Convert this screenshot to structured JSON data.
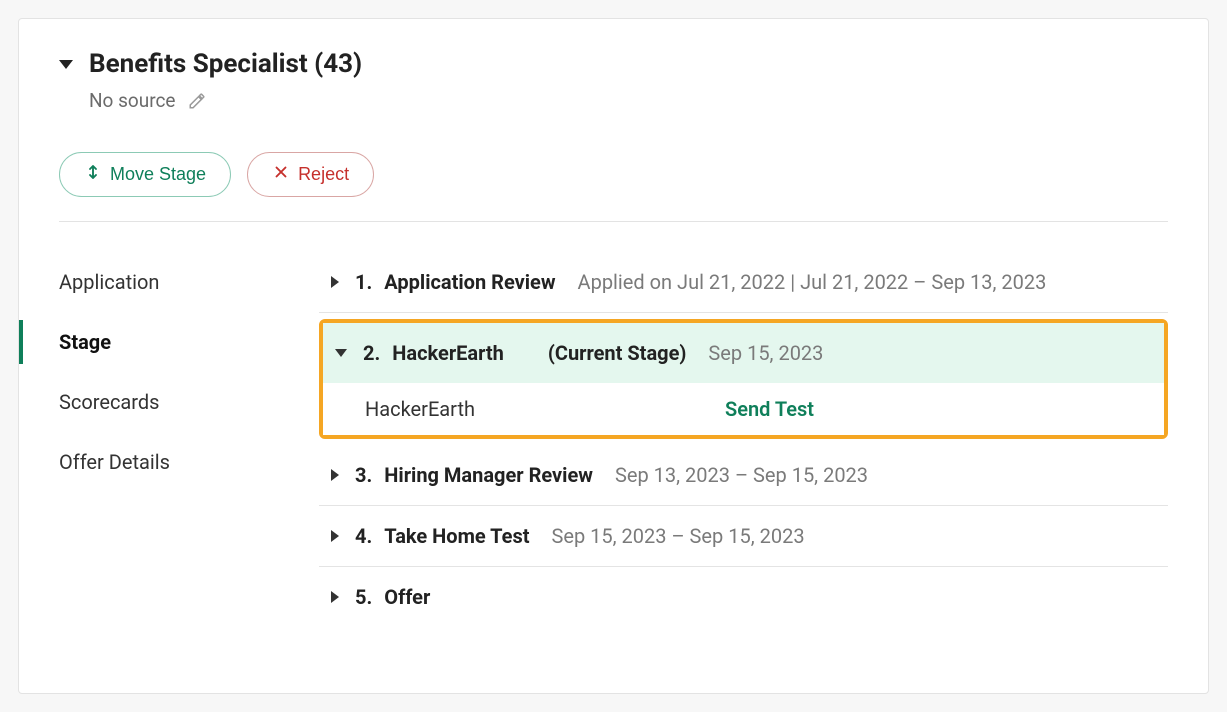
{
  "header": {
    "title": "Benefits Specialist (43)",
    "source": "No source"
  },
  "actions": {
    "move_label": "Move Stage",
    "reject_label": "Reject"
  },
  "sidebar": {
    "items": [
      {
        "label": "Application",
        "active": false
      },
      {
        "label": "Stage",
        "active": true
      },
      {
        "label": "Scorecards",
        "active": false
      },
      {
        "label": "Offer Details",
        "active": false
      }
    ]
  },
  "stages": {
    "list": [
      {
        "num": "1.",
        "name": "Application Review",
        "meta": "Applied on Jul 21, 2022 | Jul 21, 2022 – Sep 13, 2023"
      },
      {
        "num": "3.",
        "name": "Hiring Manager Review",
        "meta": "Sep 13, 2023 – Sep 15, 2023"
      },
      {
        "num": "4.",
        "name": "Take Home Test",
        "meta": "Sep 15, 2023 – Sep 15, 2023"
      },
      {
        "num": "5.",
        "name": "Offer",
        "meta": ""
      }
    ],
    "current": {
      "num": "2.",
      "name": "HackerEarth",
      "tag": "(Current Stage)",
      "meta": "Sep 15, 2023",
      "sub_name": "HackerEarth",
      "send_label": "Send Test"
    }
  }
}
